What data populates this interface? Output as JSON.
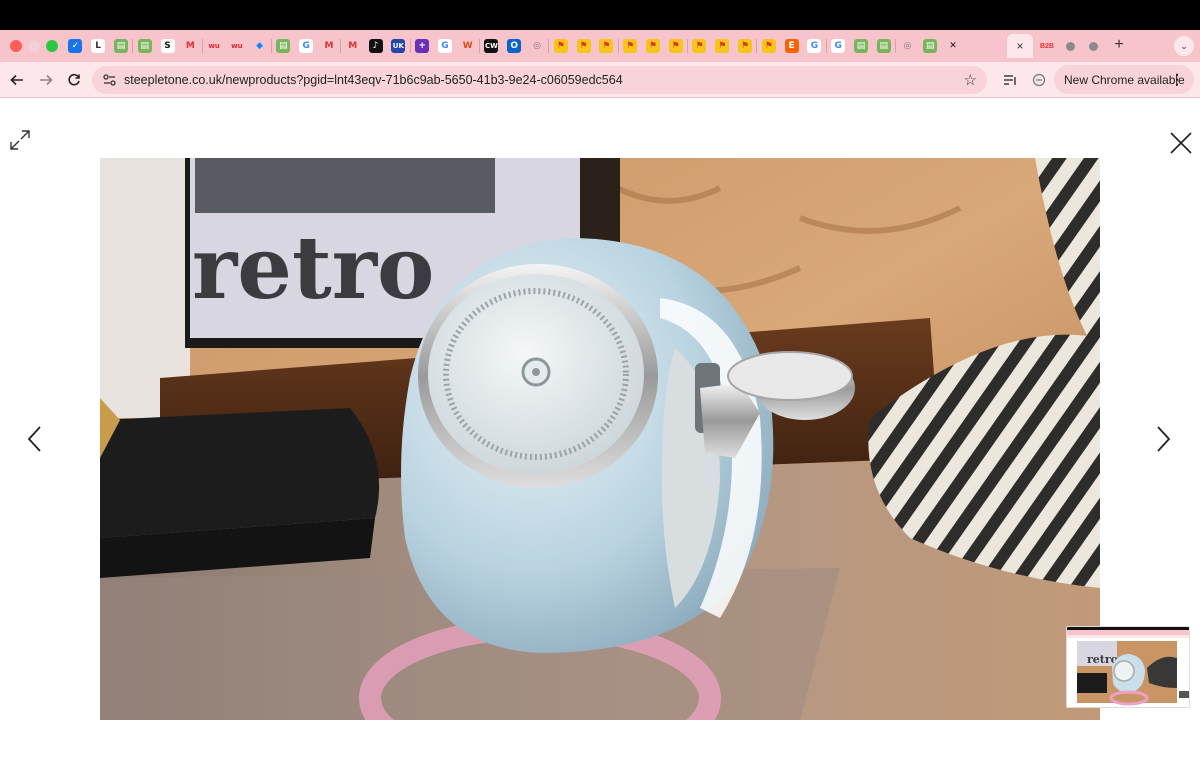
{
  "browser": {
    "tab_favicons": [
      "mail",
      "L",
      "shopify",
      "shopify",
      "S",
      "M",
      "wu",
      "wu",
      "bluesky",
      "shopify",
      "G",
      "M",
      "M",
      "tiktok",
      "UK",
      "plus",
      "G",
      "W",
      "CW",
      "outlook",
      "wa",
      "flag",
      "flag",
      "flag",
      "flag",
      "flag",
      "flag",
      "flag",
      "flag",
      "flag",
      "flag",
      "E",
      "G",
      "G",
      "shopify",
      "shopify",
      "wa",
      "shopify",
      "X"
    ],
    "active_tab_close": "×",
    "tail_tabs": [
      "B2B",
      "apple",
      "apple"
    ],
    "new_tab": "+",
    "tab_menu": "⌄",
    "url": "steepletone.co.uk/newproducts?pgid=lnt43eqv-71b6c9ab-5650-41b3-9e24-c06059edc564",
    "update_label": "New Chrome available",
    "update_menu": "⋮"
  },
  "lightbox": {
    "photo_sign_text": "retro",
    "thumb_sign_text": "retro"
  }
}
